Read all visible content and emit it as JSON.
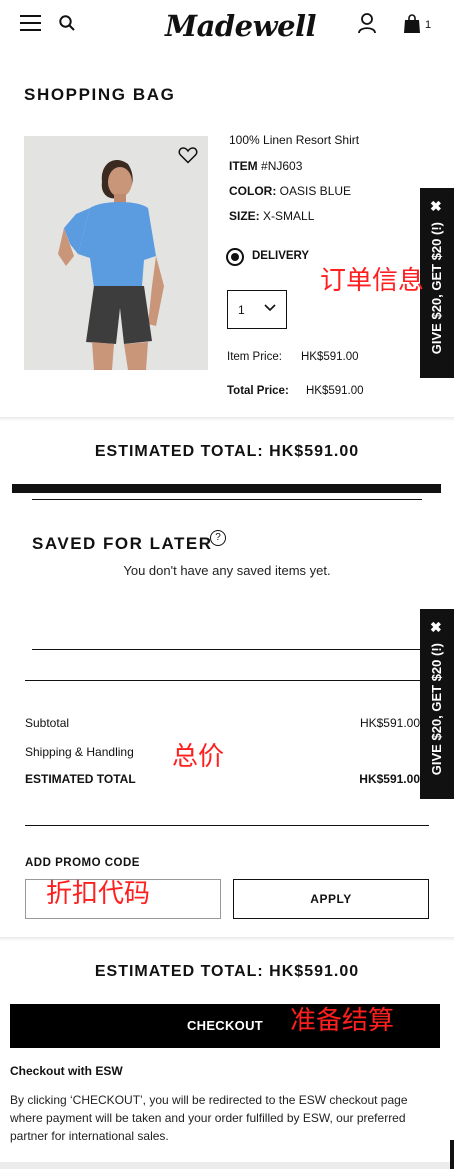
{
  "header": {
    "logo": "Madewell",
    "bag_count": "1"
  },
  "page_title": "SHOPPING BAG",
  "product": {
    "name": "100% Linen Resort Shirt",
    "item_label": "ITEM",
    "item_value": "#NJ603",
    "color_label": "COLOR:",
    "color_value": "OASIS BLUE",
    "size_label": "SIZE:",
    "size_value": "X-SMALL",
    "delivery_label": "DELIVERY",
    "quantity": "1",
    "item_price_label": "Item Price:",
    "item_price": "HK$591.00",
    "total_price_label": "Total Price:",
    "total_price": "HK$591.00"
  },
  "promo_tab": {
    "close": "✖",
    "text": "GIVE $20, GET $20 (!)"
  },
  "annotations": {
    "order_info": "订单信息",
    "total_price": "总价",
    "promo_code": "折扣代码",
    "checkout": "准备结算"
  },
  "estimated_total": "ESTIMATED TOTAL: HK$591.00",
  "saved_for_later": {
    "title": "SAVED FOR LATER",
    "help": "?",
    "empty": "You don't have any saved items yet."
  },
  "summary": {
    "subtotal_label": "Subtotal",
    "subtotal_value": "HK$591.00",
    "shipping_label": "Shipping & Handling",
    "estimated_label": "ESTIMATED TOTAL",
    "estimated_value": "HK$591.00"
  },
  "promo": {
    "label": "ADD PROMO CODE",
    "input_value": "",
    "apply_label": "APPLY"
  },
  "checkout": {
    "button_label": "CHECKOUT",
    "esw_title": "Checkout with ESW",
    "esw_desc": "By clicking ‘CHECKOUT’, you will be redirected to the ESW checkout page where payment will be taken and your order fulfilled by ESW, our preferred partner for international sales."
  }
}
